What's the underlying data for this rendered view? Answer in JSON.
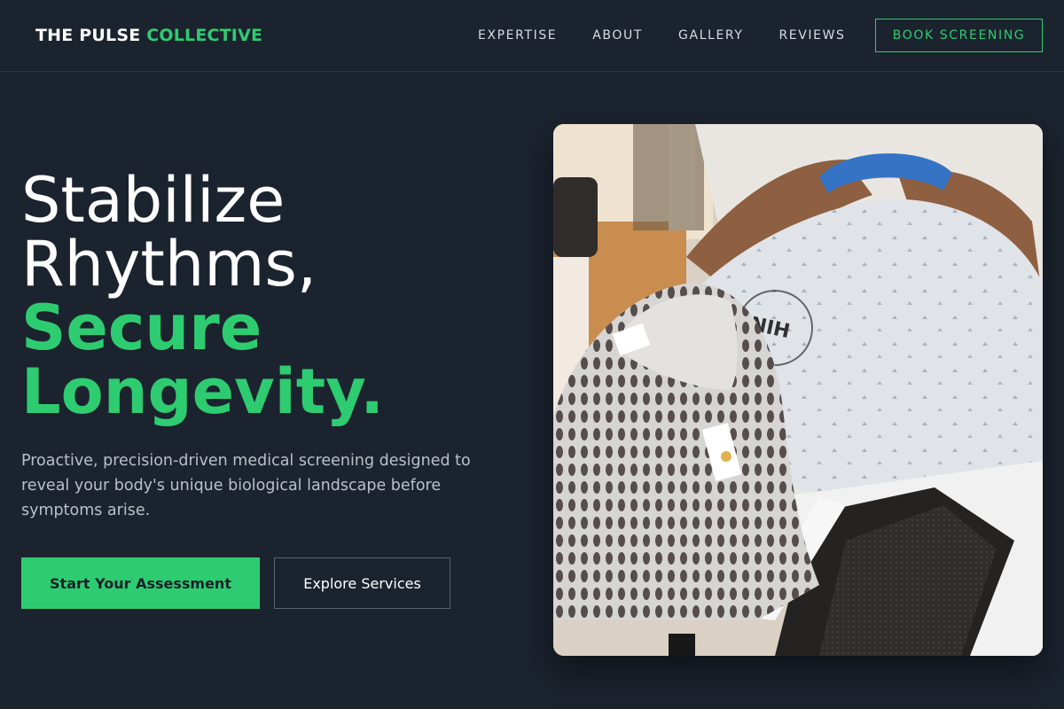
{
  "brand": {
    "name_part1": "THE PULSE",
    "name_part2": "COLLECTIVE",
    "accent_color": "#2ecc71"
  },
  "nav": {
    "items": [
      {
        "label": "EXPERTISE"
      },
      {
        "label": "ABOUT"
      },
      {
        "label": "GALLERY"
      },
      {
        "label": "REVIEWS"
      }
    ],
    "cta_label": "BOOK SCREENING"
  },
  "hero": {
    "title_line1": "Stabilize",
    "title_line2": "Rhythms,",
    "title_line3": "Secure",
    "title_line4": "Longevity.",
    "subtitle": "Proactive, precision-driven medical screening designed to reveal your body's unique biological landscape before symptoms arise.",
    "primary_button": "Start Your Assessment",
    "secondary_button": "Explore Services",
    "image_icon": "patient-radiotherapy-mask-photo",
    "image_gown_text": "NIH"
  },
  "colors": {
    "background": "#1b232e",
    "accent": "#2ecc71"
  }
}
